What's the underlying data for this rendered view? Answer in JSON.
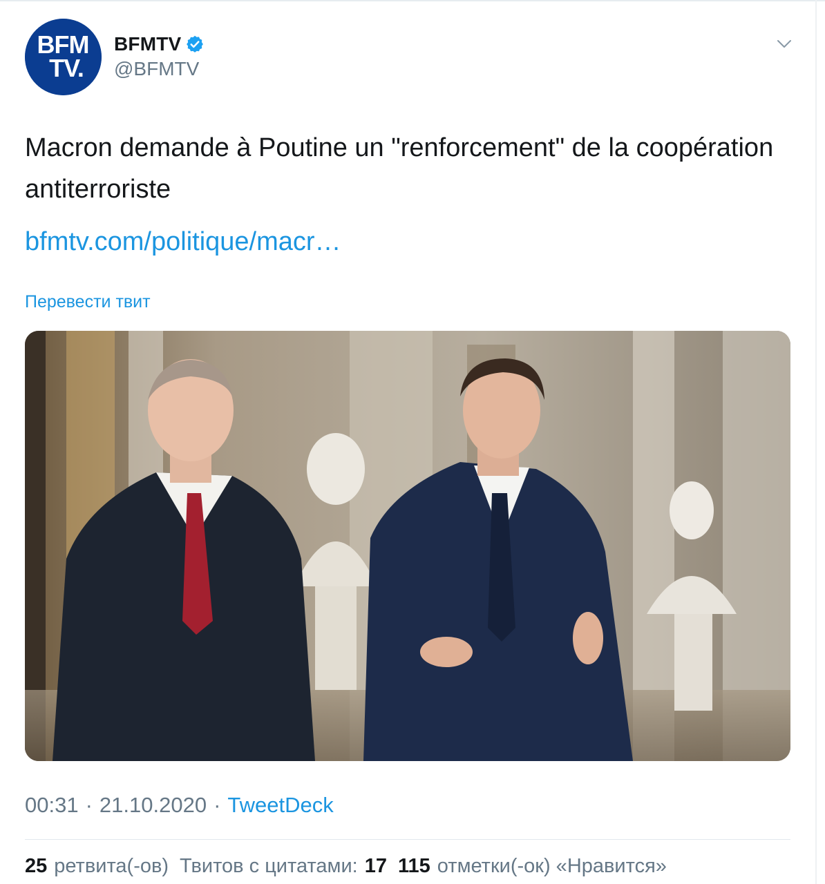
{
  "tweet": {
    "display_name": "BFMTV",
    "handle": "@BFMTV",
    "verified": true,
    "avatar_text_line1": "BFM",
    "avatar_text_line2": "TV.",
    "text": "Macron demande à Poutine un \"renforcement\" de la coopération antiterroriste",
    "link": "bfmtv.com/politique/macr…",
    "translate_label": "Перевести твит",
    "image_icon": "photo-two-men-walking-hall",
    "time": "00:31",
    "date": "21.10.2020",
    "separator": "·",
    "source": "TweetDeck"
  },
  "stats": {
    "retweets_count": "25",
    "retweets_label": "ретвита(-ов)",
    "quotes_label": "Твитов с цитатами:",
    "quotes_count": "17",
    "likes_count": "115",
    "likes_label": "отметки(-ок) «Нравится»"
  },
  "colors": {
    "accent": "#1b95e0",
    "secondary_text": "#657786",
    "primary_text": "#14171a",
    "verified": "#1da1f2",
    "avatar_bg": "#0b3d91"
  }
}
